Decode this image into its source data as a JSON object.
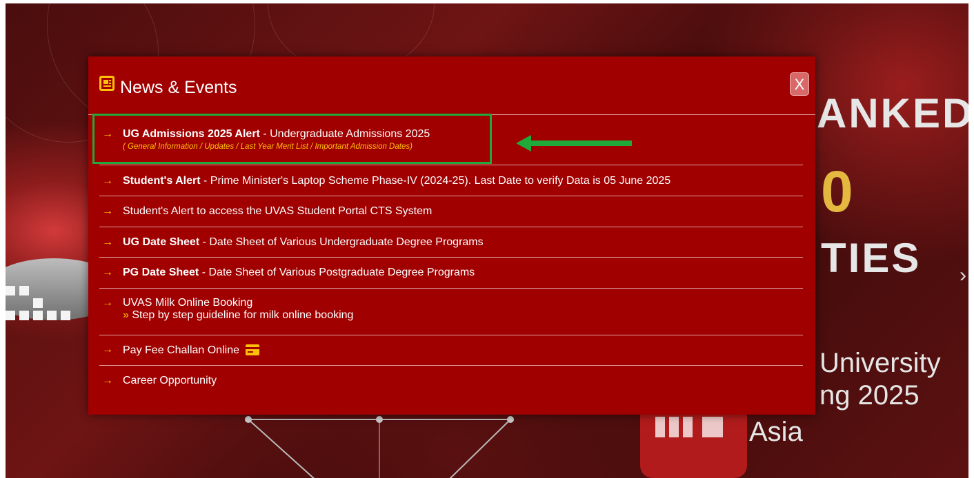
{
  "modal": {
    "title": "News & Events",
    "close_label": "X",
    "items": [
      {
        "bold": "UG Admissions 2025 Alert",
        "text": " - Undergraduate Admissions 2025",
        "subtext": "( General Information / Updates / Last Year Merit List / Important Admission Dates)"
      },
      {
        "bold": "Student's Alert",
        "text": " - Prime Minister's Laptop Scheme Phase-IV (2024-25). Last Date to verify Data is 05 June 2025"
      },
      {
        "text": "Student's Alert to access the UVAS Student Portal CTS System"
      },
      {
        "bold": "UG Date Sheet",
        "text": " - Date Sheet of Various Undergraduate Degree Programs"
      },
      {
        "bold": "PG Date Sheet",
        "text": " - Date Sheet of Various Postgraduate Degree Programs"
      },
      {
        "text": "UVAS Milk Online Booking",
        "subtext": "Step by step guideline for milk online booking",
        "subtext_prefix": "»"
      },
      {
        "text": "Pay Fee Challan Online",
        "icon": "payment-card-icon"
      },
      {
        "text": "Career Opportunity"
      }
    ],
    "arrow_glyph": "→"
  },
  "background": {
    "ranked_text": "ANKED",
    "number_text": "0",
    "ties_text": "TIES",
    "university_text": "University",
    "ranking_text": "ng 2025",
    "asia_text": "Asia",
    "next_arrow": "›"
  },
  "colors": {
    "modal_bg": "#a00000",
    "accent_yellow": "#ffc107",
    "highlight_green": "#1faa3a"
  }
}
